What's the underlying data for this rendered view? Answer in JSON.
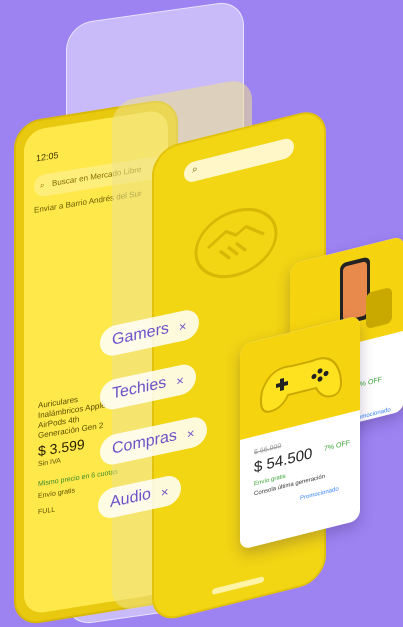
{
  "back_phone": {
    "time": "12:05",
    "search_placeholder": "Buscar en Mercado Libre",
    "address": "Enviar a Barrio Andrés del Sur",
    "product_title": "Auriculares Inalámbricos Apple AirPods 4th Generación Gen 2",
    "price": "$ 3.599",
    "price_sub": "Sin IVA",
    "installments": "Mismo precio en 6 cuotas",
    "free_shipping": "Envío gratis",
    "full": "FULL"
  },
  "chips": [
    {
      "label": "Gamers",
      "close": "×"
    },
    {
      "label": "Techies",
      "close": "×"
    },
    {
      "label": "Compras",
      "close": "×"
    },
    {
      "label": "Audio",
      "close": "×"
    }
  ],
  "card_phone": {
    "off": "31% OFF",
    "desc": "s",
    "promo": "Promocionado"
  },
  "card_controller": {
    "old_price": "$ 66.900",
    "price": "$ 54.500",
    "off": "7% OFF",
    "free_shipping": "Envío gratis",
    "desc": "Consola última generación",
    "promo": "Promocionado"
  },
  "colors": {
    "background": "#9d83f2",
    "brand_yellow": "#f2d513",
    "chip_text": "#6a53c9",
    "discount_green": "#3aa335",
    "promo_blue": "#3483fa"
  },
  "icons": [
    "search-icon",
    "mercadolibre-handshake-logo",
    "close-icon",
    "game-controller-image",
    "smartphone-image"
  ]
}
